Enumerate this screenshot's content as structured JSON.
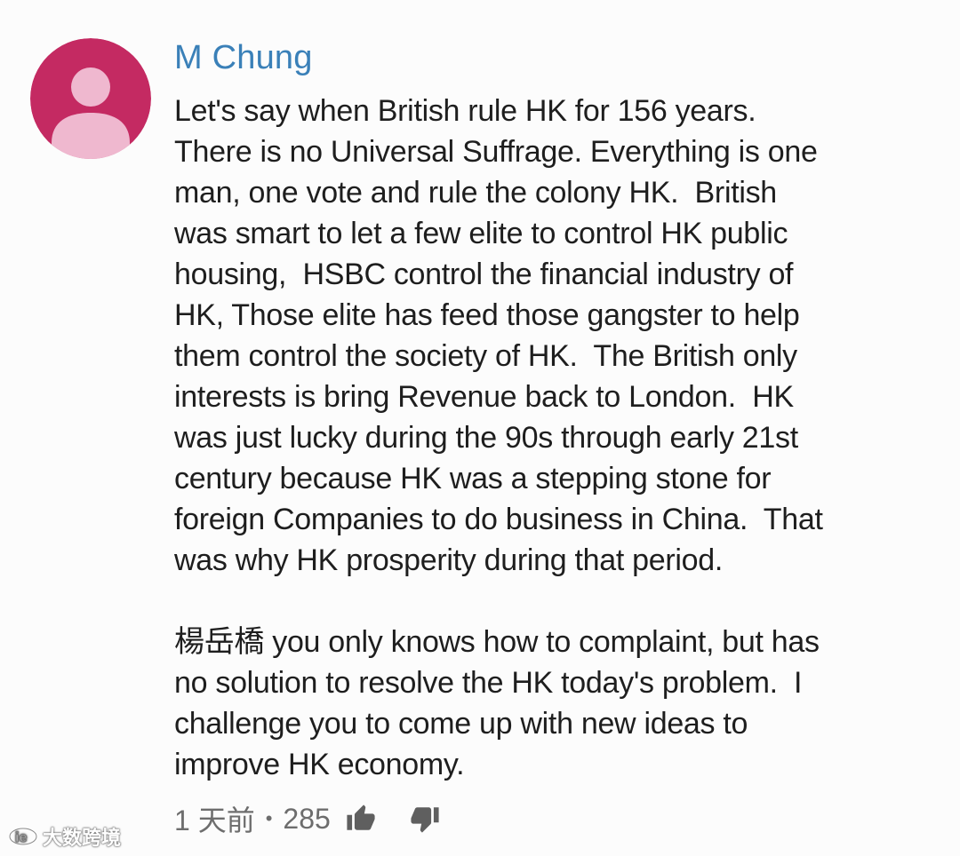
{
  "comment": {
    "author": "M Chung",
    "paragraphs": [
      [
        "Let's say when British rule HK for 156 years.",
        "There is no Universal Suffrage. Everything is one",
        "man, one vote and rule the colony HK.  British",
        "was smart to let a few elite to control HK public",
        "housing,  HSBC control the financial industry of",
        "HK, Those elite has feed those gangster to help",
        "them control the society of HK.  The British only",
        "interests is bring Revenue back to London.  HK",
        "was just lucky during the 90s through early 21st",
        "century because HK was a stepping stone for",
        "foreign Companies to do business in China.  That",
        "was why HK prosperity during that period."
      ],
      [
        "楊岳橋 you only knows how to complaint, but has",
        "no solution to resolve the HK today's problem.  I",
        "challenge you to come up with new ideas to",
        "improve HK economy."
      ]
    ],
    "time_ago": "1 天前",
    "separator": "•",
    "like_count": "285"
  },
  "watermark": {
    "text": "大数跨境"
  },
  "icons": {
    "avatar": "default-user-avatar",
    "like": "thumbs-up-icon",
    "dislike": "thumbs-down-icon",
    "watermark_logo": "ie-logo-icon"
  },
  "colors": {
    "avatar_bg": "#c42a62",
    "avatar_figure": "#efb8cf",
    "author": "#3a80b8",
    "text": "#1e1e1e",
    "meta": "#6d6d6d",
    "background": "#fcfcfc"
  }
}
